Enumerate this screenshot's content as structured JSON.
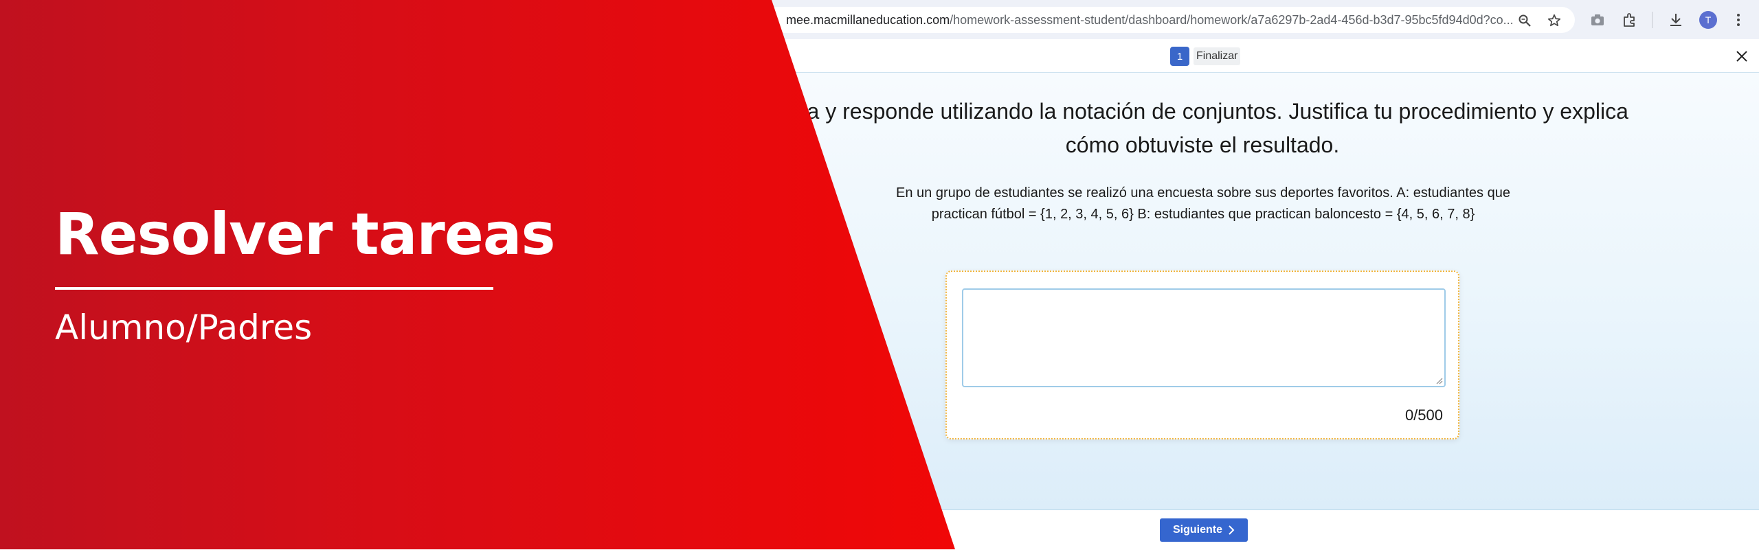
{
  "browser": {
    "url_host": "mee.macmillaneducation.com",
    "url_path": "/homework-assessment-student/dashboard/homework/a7a6297b-2ad4-456d-b3d7-95bc5fd94d0d?co...",
    "profile_initial": "T",
    "icons": [
      "zoom-icon",
      "star-icon",
      "camera-icon",
      "extensions-icon",
      "download-icon",
      "menu-icon"
    ]
  },
  "app": {
    "page_number": "1",
    "finish_label": "Finalizar",
    "close_icon": "close-icon"
  },
  "question": {
    "title": "ema y responde utilizando la notación de conjuntos. Justifica tu procedimiento y explica cómo obtuviste el resultado.",
    "description": "En un grupo de estudiantes se realizó una encuesta sobre sus deportes favoritos. A: estudiantes que practican fútbol = {1, 2, 3, 4, 5, 6} B: estudiantes que practican baloncesto = {4, 5, 6, 7, 8}",
    "answer_value": "",
    "char_count": "0/500"
  },
  "footer": {
    "next_label": "Siguiente",
    "next_icon": "chevron-right-icon"
  },
  "promo": {
    "title": "Resolver tareas",
    "subtitle": "Alumno/Padres"
  },
  "colors": {
    "promo_red": "#e00a12",
    "accent_blue": "#3566cf",
    "card_border": "#f2b53d"
  }
}
